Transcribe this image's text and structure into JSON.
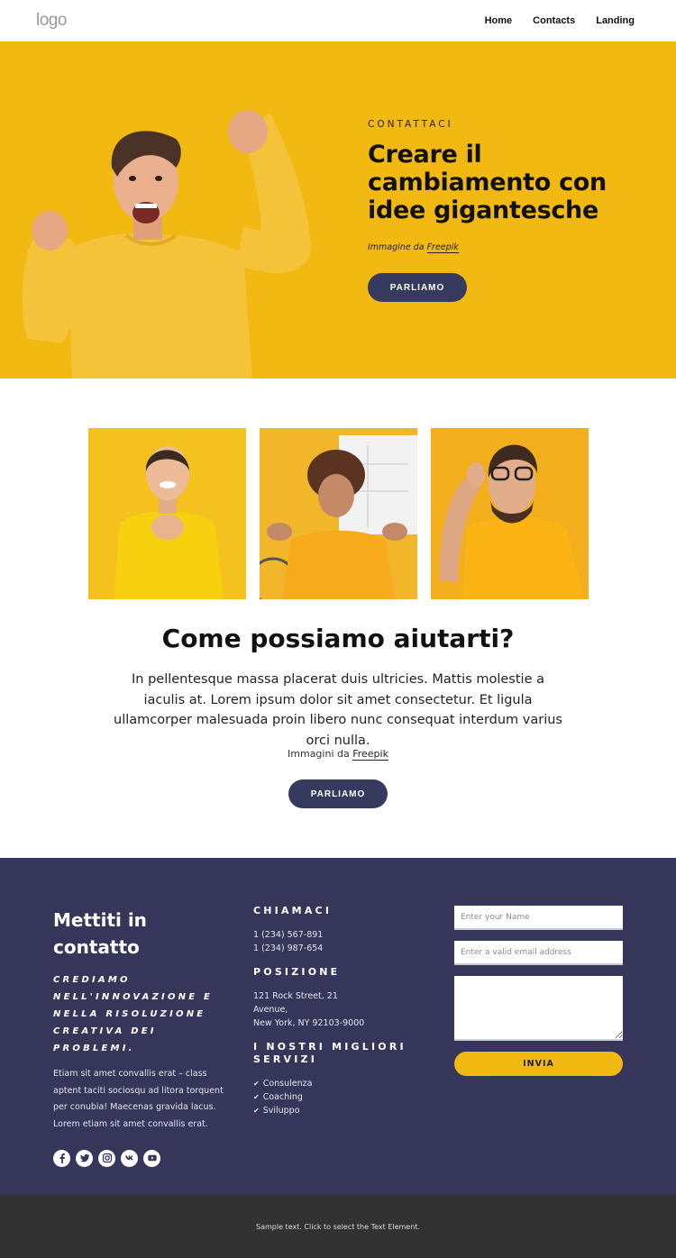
{
  "header": {
    "logo": "logo",
    "nav": [
      {
        "label": "Home"
      },
      {
        "label": "Contacts"
      },
      {
        "label": "Landing"
      }
    ]
  },
  "hero": {
    "eyebrow": "CONTATTACI",
    "title": "Creare il cambiamento con idee gigantesche",
    "credit_prefix": "Immagine da",
    "credit_link": "Freepik",
    "button": "PARLIAMO",
    "image": "man-in-yellow-sweater-cheering"
  },
  "help": {
    "gallery": [
      {
        "image": "smiling-woman-yellow-tshirt"
      },
      {
        "image": "curly-haired-woman-shrugging"
      },
      {
        "image": "surprised-man-with-glasses"
      }
    ],
    "title": "Come possiamo aiutarti?",
    "body": "In pellentesque massa placerat duis ultricies. Mattis molestie a iaculis at. Lorem ipsum dolor sit amet consectetur. Et ligula ullamcorper malesuada proin libero nunc consequat interdum varius orci nulla.",
    "credit_prefix": "Immagini da",
    "credit_link": "Freepik",
    "button": "PARLIAMO"
  },
  "contact": {
    "title": "Mettiti in contatto",
    "motto": "CREDIAMO NELL'INNOVAZIONE E NELLA RISOLUZIONE CREATIVA DEI PROBLEMI.",
    "description": "Etiam sit amet convallis erat – class aptent taciti sociosqu ad litora torquent per conubia! Maecenas gravida lacus. Lorem etiam sit amet convallis erat.",
    "socials": [
      {
        "icon": "facebook-icon"
      },
      {
        "icon": "twitter-icon"
      },
      {
        "icon": "instagram-icon"
      },
      {
        "icon": "vk-icon"
      },
      {
        "icon": "youtube-icon"
      }
    ],
    "call": {
      "heading": "CHIAMACI",
      "phones": [
        "1 (234) 567-891",
        "1 (234) 987-654"
      ]
    },
    "location": {
      "heading": "POSIZIONE",
      "lines": [
        "121 Rock Street, 21",
        "Avenue,",
        "New York, NY 92103-9000"
      ]
    },
    "services": {
      "heading": "I NOSTRI MIGLIORI SERVIZI",
      "items": [
        "Consulenza",
        "Coaching",
        "Sviluppo"
      ]
    },
    "form": {
      "name_placeholder": "Enter your Name",
      "name_value": "",
      "email_placeholder": "Enter a valid email address",
      "email_value": "",
      "message_placeholder": "",
      "message_value": "",
      "submit": "INVIA"
    }
  },
  "footer": {
    "text": "Sample text. Click to select the Text Element."
  },
  "colors": {
    "brand_yellow": "#f2b913",
    "navy": "#353659",
    "button_dark": "#353a5e",
    "footer_bg": "#323232"
  }
}
